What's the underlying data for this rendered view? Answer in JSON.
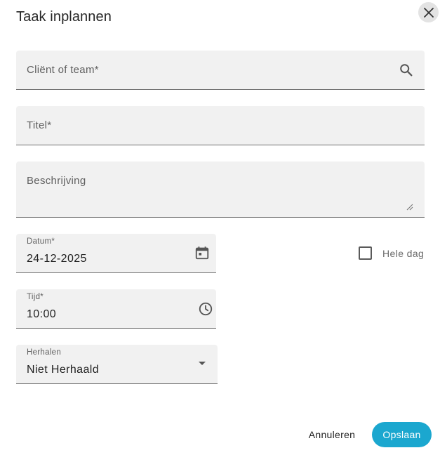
{
  "dialog": {
    "title": "Taak inplannen",
    "close_icon": "close-icon"
  },
  "fields": {
    "client": {
      "placeholder": "Cliënt of team*",
      "icon": "search-icon"
    },
    "title": {
      "placeholder": "Titel*"
    },
    "description": {
      "placeholder": "Beschrijving"
    },
    "date": {
      "label": "Datum*",
      "value": "24-12-2025",
      "icon": "calendar-icon"
    },
    "time": {
      "label": "Tijd*",
      "value": "10:00",
      "icon": "clock-icon"
    },
    "repeat": {
      "label": "Herhalen",
      "value": "Niet Herhaald",
      "icon": "dropdown-arrow-icon"
    }
  },
  "all_day": {
    "label": "Hele dag",
    "checked": false
  },
  "actions": {
    "cancel_label": "Annuleren",
    "save_label": "Opslaan"
  },
  "colors": {
    "accent": "#1ba7cf",
    "field_bg": "#f1f1f1"
  }
}
